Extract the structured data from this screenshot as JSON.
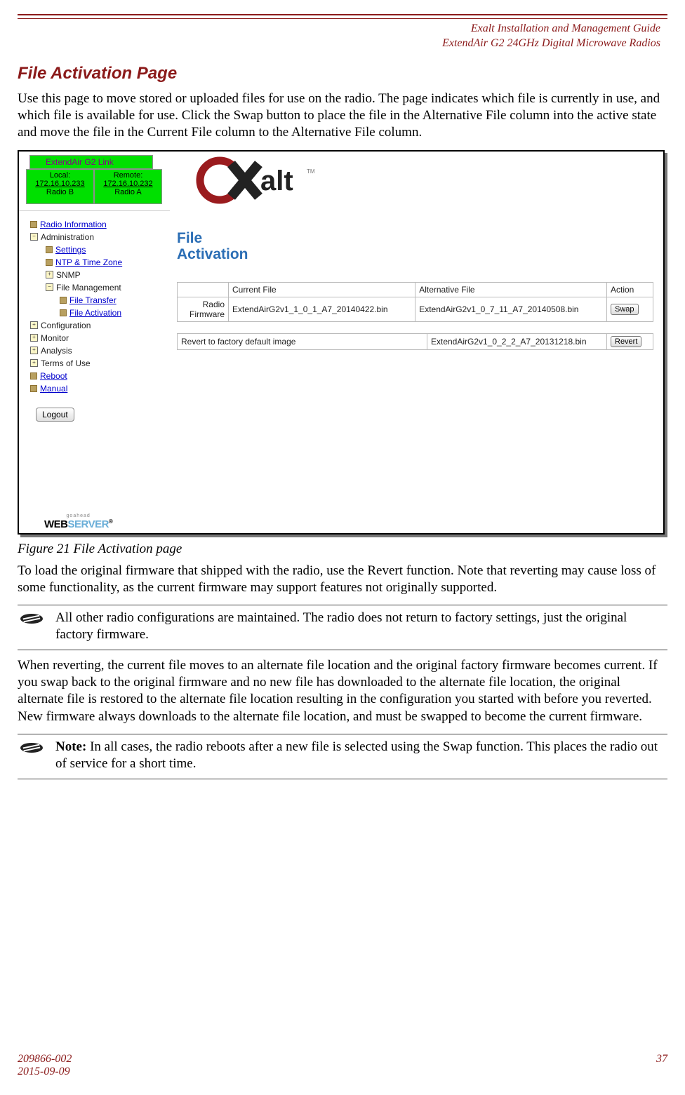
{
  "header": {
    "line1": "Exalt Installation and Management Guide",
    "line2": "ExtendAir G2 24GHz Digital Microwave Radios"
  },
  "section_heading": "File Activation Page",
  "para1": "Use this page to move stored or uploaded files for use on the radio. The page indicates which file is currently in use, and which file is available for use. Click the Swap button to place the file in the Alternative File column into the active state and move the file in the Current File column to the Alternative File column.",
  "figure": {
    "link_name": "ExtendAir G2 Link",
    "local": {
      "label": "Local:",
      "ip": "172.16.10.233",
      "radio": "Radio B"
    },
    "remote": {
      "label": "Remote:",
      "ip": "172.16.10.232",
      "radio": "Radio A"
    },
    "nav": {
      "radio_info": "Radio Information",
      "administration": "Administration",
      "settings": "Settings",
      "ntp": "NTP & Time Zone",
      "snmp": "SNMP",
      "file_mgmt": "File Management",
      "file_transfer": "File Transfer",
      "file_activation": "File Activation",
      "configuration": "Configuration",
      "monitor": "Monitor",
      "analysis": "Analysis",
      "terms": "Terms of Use",
      "reboot": "Reboot",
      "manual": "Manual",
      "logout": "Logout"
    },
    "webserver": {
      "goahead": "goahead",
      "web": "WEB",
      "server": "SERVER"
    },
    "content": {
      "title_l1": "File",
      "title_l2": "Activation",
      "swap_table": {
        "col_current": "Current File",
        "col_alt": "Alternative File",
        "col_action": "Action",
        "row_label_l1": "Radio",
        "row_label_l2": "Firmware",
        "current_val": "ExtendAirG2v1_1_0_1_A7_20140422.bin",
        "alt_val": "ExtendAirG2v1_0_7_11_A7_20140508.bin",
        "swap_btn": "Swap"
      },
      "revert_table": {
        "label": "Revert to factory default image",
        "file": "ExtendAirG2v1_0_2_2_A7_20131218.bin",
        "revert_btn": "Revert"
      }
    }
  },
  "fig_caption": "Figure 21   File Activation page",
  "para2": "To load the original firmware that shipped with the radio, use the Revert function. Note that reverting may cause loss of some functionality, as the current firmware may support features not originally supported.",
  "note1": "All other radio configurations are maintained. The radio does not return to factory settings, just the original factory firmware.",
  "para3": "When reverting, the current file moves to an alternate file location and the original factory firmware becomes current. If you swap back to the original firmware and no new file has downloaded to the alternate file location, the original alternate file is restored to the alternate file location resulting in the configuration you started with before you reverted. New firmware always downloads to the alternate file location, and must be swapped to become the current firmware.",
  "note2": {
    "bold": "Note: ",
    "text": "In all cases, the radio reboots after a new file is selected using the Swap function. This places the radio out of service for a short time."
  },
  "footer": {
    "docnum": "209866-002",
    "date": "2015-09-09",
    "pagenum": "37"
  }
}
